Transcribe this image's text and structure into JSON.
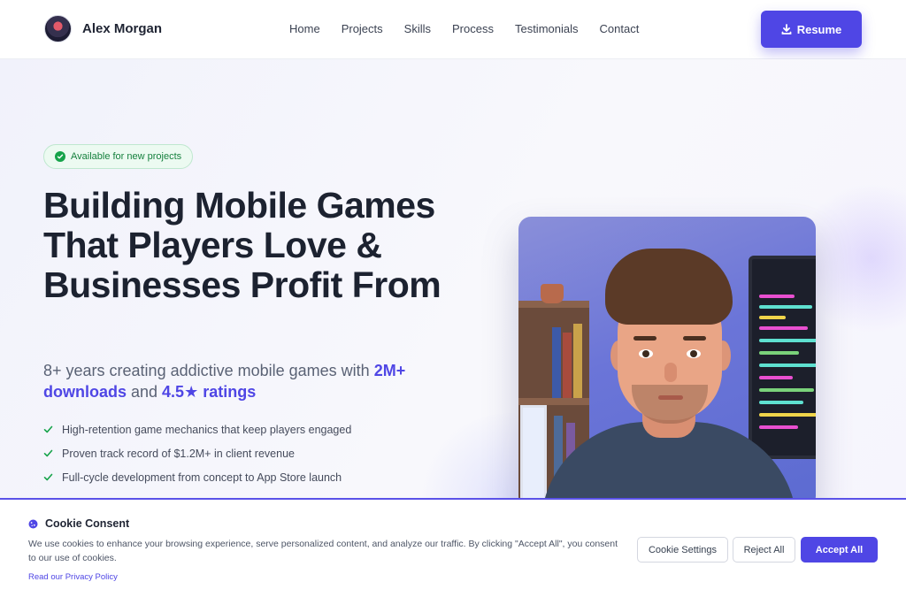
{
  "header": {
    "brand_name": "Alex Morgan",
    "nav": [
      "Home",
      "Projects",
      "Skills",
      "Process",
      "Testimonials",
      "Contact"
    ],
    "resume_label": "Resume"
  },
  "hero": {
    "badge": "Available for new projects",
    "headline": "Building Mobile Games That Players Love & Businesses Profit From",
    "sub_prefix": "8+ years creating addictive mobile games with ",
    "sub_downloads": "2M+ downloads",
    "sub_and": " and ",
    "sub_ratings": "4.5★ ratings",
    "bullets": [
      "High-retention game mechanics that keep players engaged",
      "Proven track record of $1.2M+ in client revenue",
      "Full-cycle development from concept to App Store launch"
    ]
  },
  "cookie": {
    "title": "Cookie Consent",
    "text": "We use cookies to enhance your browsing experience, serve personalized content, and analyze our traffic. By clicking \"Accept All\", you consent to our use of cookies.",
    "privacy_link": "Read our Privacy Policy",
    "settings_label": "Cookie Settings",
    "reject_label": "Reject All",
    "accept_label": "Accept All"
  },
  "colors": {
    "accent": "#4f46e5",
    "success": "#16a34a",
    "text_dark": "#1c2230"
  },
  "icons": {
    "badge": "check-circle-icon",
    "resume": "download-icon",
    "bullets": "check-icon",
    "cookie": "cookie-icon"
  }
}
